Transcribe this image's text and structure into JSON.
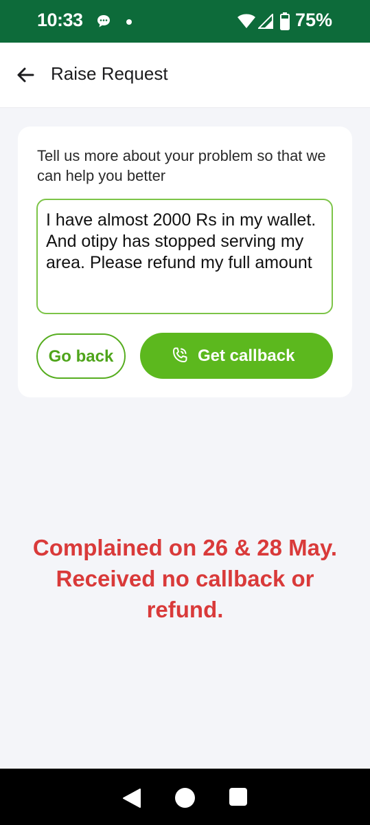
{
  "status_bar": {
    "time": "10:33",
    "battery_percent": "75%",
    "icons": [
      "chat-icon",
      "dot-icon",
      "wifi-icon",
      "signal-icon",
      "battery-icon"
    ],
    "background_color": "#0d6b3a"
  },
  "header": {
    "title": "Raise Request",
    "back_icon": "back-arrow-icon"
  },
  "form": {
    "prompt": "Tell us more about your problem so that we can help you better",
    "problem_text": "I have almost 2000 Rs in my wallet. And otipy has stopped serving my area. Please refund my full amount",
    "go_back_label": "Go back",
    "callback_label": "Get callback",
    "callback_icon": "phone-call-icon",
    "accent_color": "#5cb81e"
  },
  "annotation": {
    "text": "Complained on 26 & 28 May. Received no callback or refund.",
    "color": "#d93a3a"
  },
  "nav_bar": {
    "buttons": [
      "nav-back-icon",
      "nav-home-icon",
      "nav-recents-icon"
    ]
  }
}
